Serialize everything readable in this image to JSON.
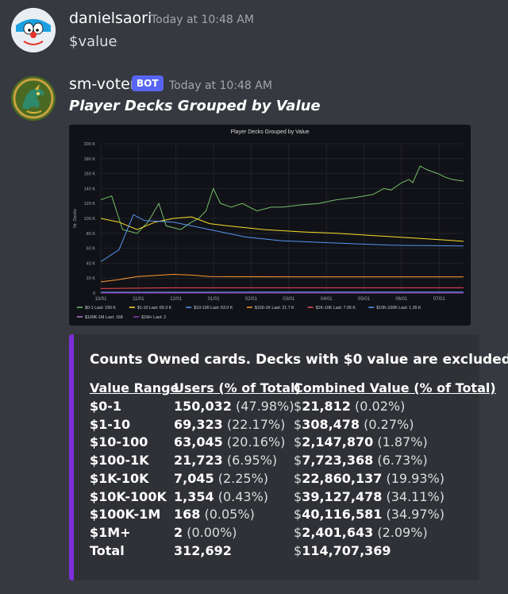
{
  "messages": [
    {
      "username": "danielsaori",
      "timestamp": "Today at 10:48 AM",
      "text": "$value"
    },
    {
      "username": "sm-voter",
      "bot_tag": "BOT",
      "timestamp": "Today at 10:48 AM",
      "embed_title": "Player Decks Grouped by Value"
    }
  ],
  "chart_data": {
    "type": "line",
    "title": "Player Decks Grouped by Value",
    "ylabel": "Nr. Decks",
    "xlabel": "",
    "ylim": [
      0,
      200000
    ],
    "y_ticks": [
      "0",
      "20 K",
      "40 K",
      "60 K",
      "80 K",
      "100 K",
      "120 K",
      "140 K",
      "160 K",
      "180 K",
      "200 K"
    ],
    "x_ticks": [
      "10/01",
      "11/01",
      "12/01",
      "01/01",
      "02/01",
      "03/01",
      "04/01",
      "05/01",
      "06/01",
      "07/01"
    ],
    "grid": true,
    "legend_placement": "bottom",
    "series": [
      {
        "name": "$0-1",
        "last": "Last: 150 K",
        "color": "#73bf69",
        "points": [
          [
            0,
            125000
          ],
          [
            0.03,
            130000
          ],
          [
            0.06,
            85000
          ],
          [
            0.1,
            80000
          ],
          [
            0.13,
            95000
          ],
          [
            0.16,
            120000
          ],
          [
            0.18,
            90000
          ],
          [
            0.22,
            85000
          ],
          [
            0.25,
            95000
          ],
          [
            0.27,
            100000
          ],
          [
            0.29,
            110000
          ],
          [
            0.31,
            140000
          ],
          [
            0.33,
            120000
          ],
          [
            0.36,
            115000
          ],
          [
            0.39,
            120000
          ],
          [
            0.43,
            110000
          ],
          [
            0.47,
            115000
          ],
          [
            0.5,
            115000
          ],
          [
            0.55,
            118000
          ],
          [
            0.6,
            120000
          ],
          [
            0.65,
            125000
          ],
          [
            0.7,
            128000
          ],
          [
            0.75,
            132000
          ],
          [
            0.78,
            140000
          ],
          [
            0.8,
            138000
          ],
          [
            0.83,
            148000
          ],
          [
            0.85,
            152000
          ],
          [
            0.86,
            148000
          ],
          [
            0.88,
            170000
          ],
          [
            0.9,
            165000
          ],
          [
            0.93,
            160000
          ],
          [
            0.95,
            155000
          ],
          [
            0.97,
            152000
          ],
          [
            1,
            150000
          ]
        ]
      },
      {
        "name": "$1-10",
        "last": "Last: 69.3 K",
        "color": "#fade2a",
        "points": [
          [
            0,
            100000
          ],
          [
            0.05,
            95000
          ],
          [
            0.1,
            85000
          ],
          [
            0.15,
            95000
          ],
          [
            0.2,
            100000
          ],
          [
            0.25,
            102000
          ],
          [
            0.3,
            93000
          ],
          [
            0.35,
            90000
          ],
          [
            0.45,
            85000
          ],
          [
            0.55,
            82000
          ],
          [
            0.65,
            80000
          ],
          [
            0.75,
            77000
          ],
          [
            0.85,
            74000
          ],
          [
            0.95,
            71000
          ],
          [
            1,
            69300
          ]
        ]
      },
      {
        "name": "$10-100",
        "last": "Last: 63.0 K",
        "color": "#5794f2",
        "points": [
          [
            0,
            42000
          ],
          [
            0.05,
            58000
          ],
          [
            0.09,
            105000
          ],
          [
            0.12,
            97000
          ],
          [
            0.2,
            95000
          ],
          [
            0.25,
            90000
          ],
          [
            0.3,
            85000
          ],
          [
            0.4,
            75000
          ],
          [
            0.5,
            70000
          ],
          [
            0.6,
            68000
          ],
          [
            0.7,
            66000
          ],
          [
            0.8,
            64000
          ],
          [
            0.9,
            63500
          ],
          [
            1,
            63000
          ]
        ]
      },
      {
        "name": "$100-1K",
        "last": "Last: 21.7 K",
        "color": "#ff9830",
        "points": [
          [
            0,
            15000
          ],
          [
            0.05,
            18000
          ],
          [
            0.1,
            22000
          ],
          [
            0.2,
            25000
          ],
          [
            0.25,
            24000
          ],
          [
            0.3,
            22000
          ],
          [
            0.4,
            21800
          ],
          [
            0.6,
            21700
          ],
          [
            0.8,
            21700
          ],
          [
            1,
            21700
          ]
        ]
      },
      {
        "name": "$1K-10K",
        "last": "Last: 7.05 K",
        "color": "#f2495c",
        "points": [
          [
            0,
            6000
          ],
          [
            0.2,
            7000
          ],
          [
            0.5,
            7000
          ],
          [
            1,
            7050
          ]
        ]
      },
      {
        "name": "$10K-100K",
        "last": "Last: 1.35 K",
        "color": "#5794f2",
        "points": [
          [
            0,
            1200
          ],
          [
            0.5,
            1300
          ],
          [
            1,
            1350
          ]
        ]
      },
      {
        "name": "$100K-1M",
        "last": "Last: 168",
        "color": "#b877d9",
        "points": [
          [
            0,
            160
          ],
          [
            1,
            168
          ]
        ]
      },
      {
        "name": "$1M+",
        "last": "Last: 2",
        "color": "#8f3bb8",
        "points": [
          [
            0,
            2
          ],
          [
            1,
            2
          ]
        ]
      }
    ]
  },
  "embed": {
    "description": "Counts Owned cards. Decks with $0 value are excluded.",
    "headers": [
      "Value Range",
      "Users (% of Total)",
      "Combined Value (% of Total)"
    ],
    "rows": [
      {
        "range": "$0-1",
        "users": "150,032",
        "users_pct": " (47.98%)",
        "value_prefix": "$",
        "value": "21,812",
        "value_pct": " (0.02%)"
      },
      {
        "range": "$1-10",
        "users": "69,323",
        "users_pct": " (22.17%)",
        "value_prefix": "$",
        "value": "308,478",
        "value_pct": " (0.27%)"
      },
      {
        "range": "$10-100",
        "users": "63,045",
        "users_pct": " (20.16%)",
        "value_prefix": "$",
        "value": "2,147,870",
        "value_pct": " (1.87%)"
      },
      {
        "range": "$100-1K",
        "users": "21,723",
        "users_pct": " (6.95%)",
        "value_prefix": "$",
        "value": "7,723,368",
        "value_pct": " (6.73%)"
      },
      {
        "range": "$1K-10K",
        "users": "7,045",
        "users_pct": " (2.25%)",
        "value_prefix": "$",
        "value": "22,860,137",
        "value_pct": " (19.93%)"
      },
      {
        "range": "$10K-100K",
        "users": "1,354",
        "users_pct": " (0.43%)",
        "value_prefix": "$",
        "value": "39,127,478",
        "value_pct": " (34.11%)"
      },
      {
        "range": "$100K-1M",
        "users": "168",
        "users_pct": " (0.05%)",
        "value_prefix": "$",
        "value": "40,116,581",
        "value_pct": " (34.97%)"
      },
      {
        "range": "$1M+",
        "users": "2",
        "users_pct": " (0.00%)",
        "value_prefix": "$",
        "value": "2,401,643",
        "value_pct": " (2.09%)"
      },
      {
        "range": "Total",
        "users": "312,692",
        "users_pct": "",
        "value_prefix": "$",
        "value": "114,707,369",
        "value_pct": ""
      }
    ]
  }
}
